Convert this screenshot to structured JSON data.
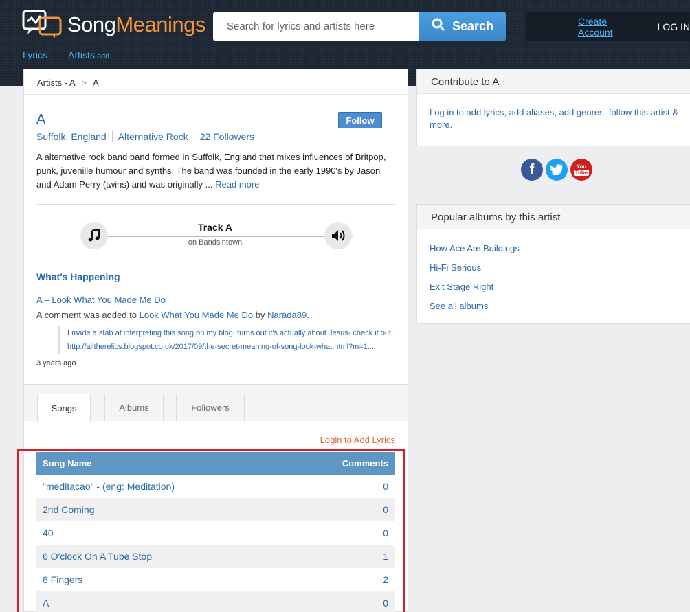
{
  "header": {
    "logo_song": "Song",
    "logo_meanings": "Meanings",
    "search_placeholder": "Search for lyrics and artists here",
    "search_label": "Search",
    "create_account": "Create Account",
    "login": "LOG IN",
    "nav": {
      "lyrics": "Lyrics",
      "artists": "Artists",
      "add": "add"
    }
  },
  "breadcrumb": {
    "parent": "Artists - A",
    "sep": ">",
    "current": "A"
  },
  "artist": {
    "name": "A",
    "location": "Suffolk, England",
    "genre": "Alternative Rock",
    "followers": "22 Followers",
    "follow_label": "Follow",
    "description": "A alternative rock band band formed in Suffolk, England that mixes influences of Britpop, punk, juvenille humour and synths. The band was founded in the early 1990's by Jason and Adam Perry (twins) and was originally ...",
    "read_more": "Read more"
  },
  "track": {
    "title": "Track A",
    "source": "on Bandsintown"
  },
  "happening": {
    "title": "What's Happening",
    "item_title": "A – Look What You Made Me Do",
    "comment_prefix": "A comment was added to",
    "comment_song": "Look What You Made Me Do",
    "comment_by": "by",
    "comment_user": "Narada89.",
    "quote_line1": "I made a stab at interpreting this song on my blog, turns out it's actually about Jesus- check it out:",
    "quote_line2": "http://alltherelics.blogspot.co.uk/2017/09/the-secret-meaning-of-song-look-what.html?m=1...",
    "time": "3 years ago"
  },
  "tabs": [
    {
      "label": "Songs",
      "active": true
    },
    {
      "label": "Albums",
      "active": false
    },
    {
      "label": "Followers",
      "active": false
    }
  ],
  "login_add_lyrics": "Login to Add Lyrics",
  "songs_table": {
    "headers": {
      "name": "Song Name",
      "comments": "Comments"
    },
    "rows": [
      {
        "name": "\"meditacao\" - (eng: Meditation)",
        "comments": "0"
      },
      {
        "name": "2nd Coming",
        "comments": "0"
      },
      {
        "name": "40",
        "comments": "0"
      },
      {
        "name": "6 O'clock On A Tube Stop",
        "comments": "1"
      },
      {
        "name": "8 Fingers",
        "comments": "2"
      },
      {
        "name": "A",
        "comments": "0"
      }
    ]
  },
  "contribute": {
    "title": "Contribute to A",
    "body": "Log in to add lyrics, add aliases, add genres, follow this artist & more."
  },
  "social": {
    "facebook": "f",
    "youtube_you": "You",
    "youtube_tube": "Tube",
    "colors": {
      "facebook": "#3b5998",
      "twitter": "#1da1f2",
      "youtube": "#cd201f"
    }
  },
  "popular_albums": {
    "title": "Popular albums by this artist",
    "items": [
      "How Ace Are Buildings",
      "Hi-Fi Serious",
      "Exit Stage Right",
      "See all albums"
    ]
  }
}
